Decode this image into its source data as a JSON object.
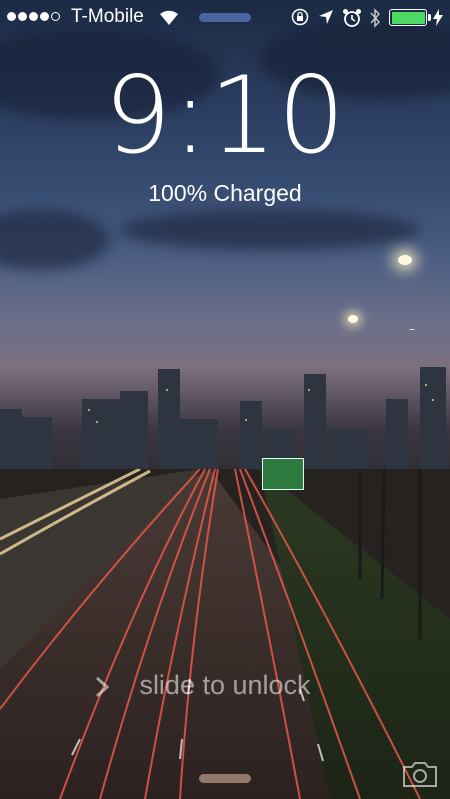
{
  "status_bar": {
    "signal_dots": [
      true,
      true,
      true,
      true,
      false
    ],
    "carrier": "T-Mobile",
    "icons": [
      "wifi-icon",
      "orientation-lock-icon",
      "location-arrow-icon",
      "alarm-icon",
      "bluetooth-icon",
      "battery-icon",
      "charging-bolt-icon"
    ],
    "battery_level": 1.0,
    "battery_color": "#4cd964"
  },
  "lock_screen": {
    "time": "9:10",
    "charge_status": "100% Charged",
    "slide_text": "slide to unlock"
  },
  "colors": {
    "text": "#ffffff",
    "battery": "#4cd964"
  }
}
